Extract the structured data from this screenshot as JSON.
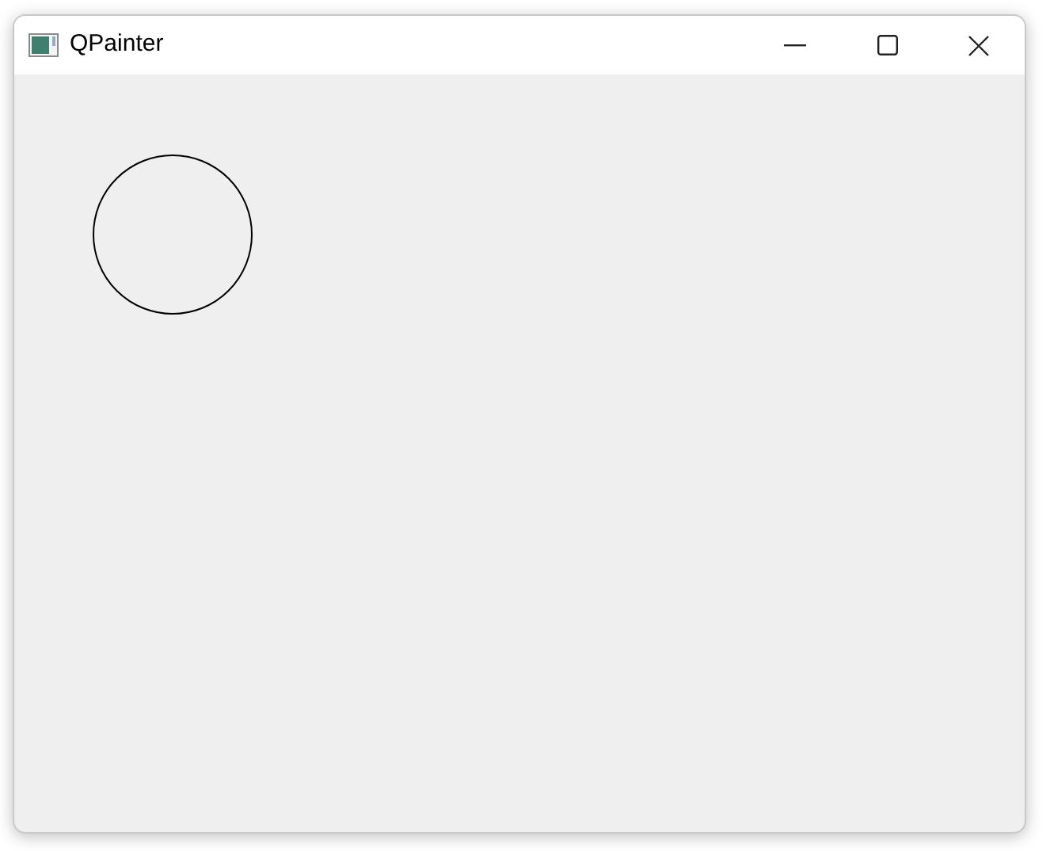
{
  "window": {
    "title": "QPainter"
  }
}
